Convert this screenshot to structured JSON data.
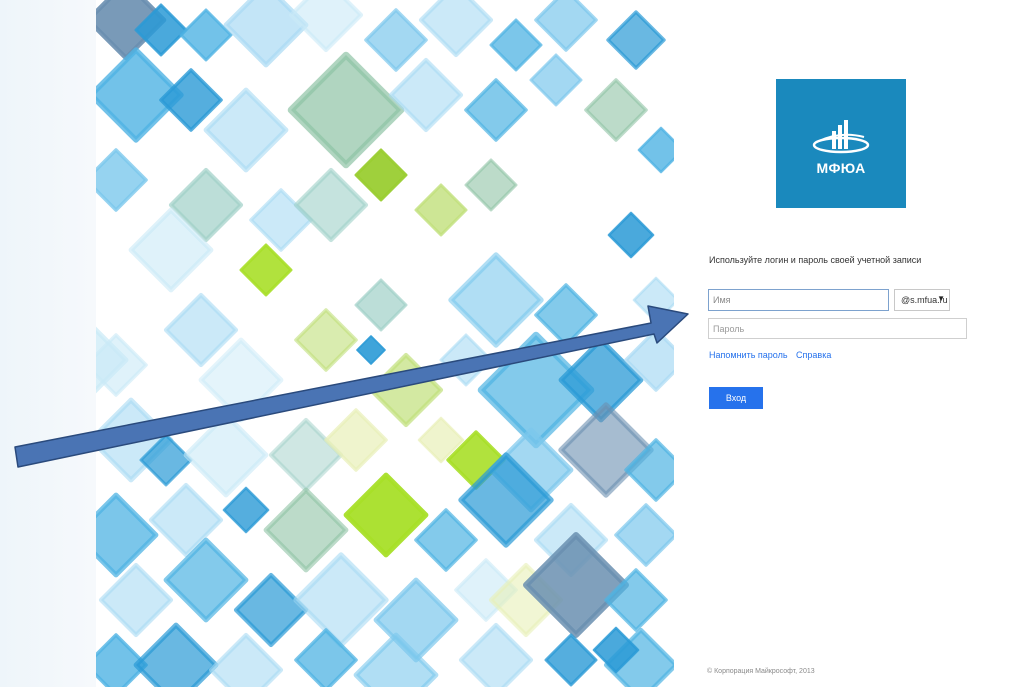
{
  "logo": {
    "text": "МФЮА",
    "icon": "mfua-building-orbit-icon",
    "color": "#1a89bd"
  },
  "login": {
    "instruction": "Используйте логин и пароль своей учетной записи",
    "username_placeholder": "Имя",
    "domain_value": "@s.mfua.ru",
    "domain_arrow": "▼",
    "password_placeholder": "Пароль",
    "links": [
      {
        "label": "Напомнить пароль"
      },
      {
        "label": "Справка"
      }
    ],
    "signin_label": "Вход"
  },
  "footer": {
    "copyright": "© Корпорация Майкрософт, 2013"
  },
  "colors": {
    "accent_blue": "#2672ec",
    "annotation_arrow": "#4a74b4",
    "annotation_outline": "#2a4a7c"
  },
  "annotation": {
    "icon": "pointer-arrow-icon"
  }
}
